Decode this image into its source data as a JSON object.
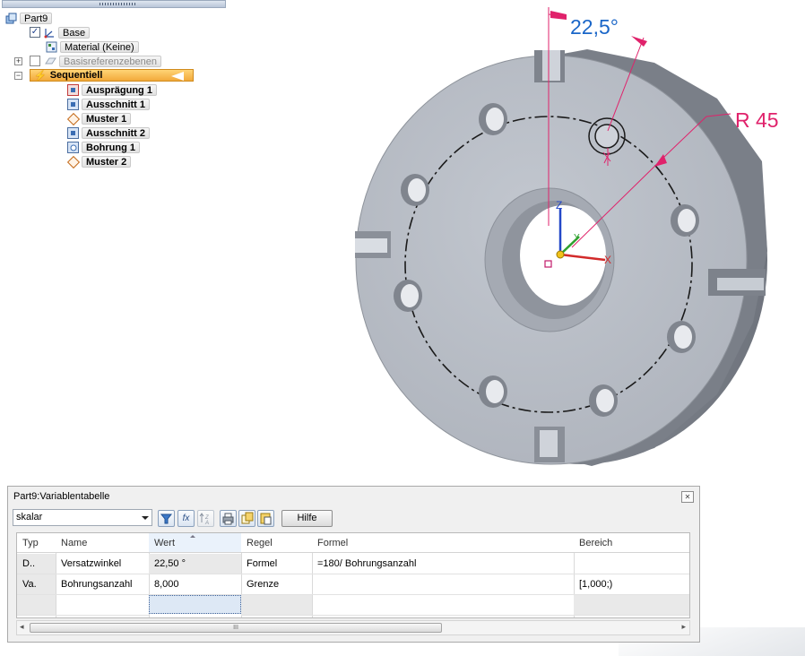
{
  "tree": {
    "part": "Part9",
    "base": "Base",
    "material": "Material (Keine)",
    "reference_planes": "Basisreferenzebenen",
    "sequential": "Sequentiell",
    "features": [
      {
        "label": "Ausprägung 1",
        "icon": "protrusion-icon"
      },
      {
        "label": "Ausschnitt 1",
        "icon": "cutout-icon"
      },
      {
        "label": "Muster 1",
        "icon": "pattern-icon"
      },
      {
        "label": "Ausschnitt 2",
        "icon": "cutout-icon"
      },
      {
        "label": "Bohrung 1",
        "icon": "hole-icon"
      },
      {
        "label": "Muster 2",
        "icon": "pattern-icon"
      }
    ]
  },
  "viewport": {
    "angle_dimension": "22,5°",
    "radius_dimension": "R 45",
    "axis_labels": {
      "x": "X",
      "y": "Y",
      "z": "Z"
    },
    "colors": {
      "part": "#b7bcc5",
      "angle_dim": "#1a66c8",
      "radius_dim": "#e0226b"
    }
  },
  "variable_table": {
    "title": "Part9:Variablentabelle",
    "filter": "skalar",
    "help_label": "Hilfe",
    "columns": [
      "Typ",
      "Name",
      "Wert",
      "Regel",
      "Formel",
      "Bereich"
    ],
    "rows": [
      {
        "typ": "D..",
        "name": "Versatzwinkel",
        "wert": "22,50 °",
        "regel": "Formel",
        "formel": "=180/ Bohrungsanzahl",
        "bereich": ""
      },
      {
        "typ": "Va.",
        "name": "Bohrungsanzahl",
        "wert": "8,000",
        "regel": "Grenze",
        "formel": "",
        "bereich": "[1,000;)"
      }
    ],
    "scroll_grip": "III"
  }
}
